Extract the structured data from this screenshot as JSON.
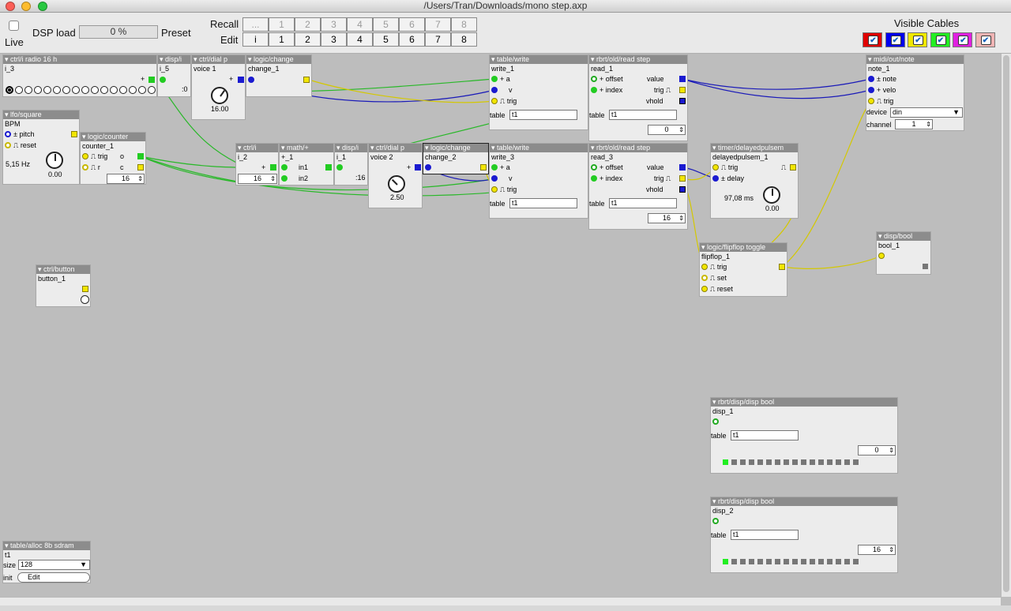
{
  "window": {
    "title": "/Users/Tran/Downloads/mono step.axp"
  },
  "toolbar": {
    "live_label": "Live",
    "dsp_label": "DSP load",
    "dsp_value": "0 %",
    "preset_label": "Preset",
    "recall_label": "Recall",
    "edit_label": "Edit",
    "recall_cells": [
      "...",
      "1",
      "2",
      "3",
      "4",
      "5",
      "6",
      "7",
      "8"
    ],
    "edit_cells": [
      "i",
      "1",
      "2",
      "3",
      "4",
      "5",
      "6",
      "7",
      "8"
    ],
    "visible_cables_label": "Visible Cables",
    "cable_colors": [
      "#e00000",
      "#0000ee",
      "#f0e800",
      "#22ee22",
      "#e020e0",
      "#f0b4b4"
    ],
    "check_mark": "✔"
  },
  "objects": {
    "radio": {
      "title": "ctrl/i radio 16 h",
      "name": "i_3",
      "plus": "+"
    },
    "disp_i5": {
      "title": "disp/i",
      "name": "i_5",
      "value": ":0"
    },
    "dial1": {
      "title": "ctrl/dial p",
      "name": "voice 1",
      "value": "16.00",
      "plus": "+"
    },
    "change1": {
      "title": "logic/change",
      "name": "change_1"
    },
    "lfo": {
      "title": "lfo/square",
      "name": "BPM",
      "pitch": "pitch",
      "reset": "reset",
      "freq": "5,15 Hz",
      "value": "0.00",
      "pm": "±"
    },
    "counter": {
      "title": "logic/counter",
      "name": "counter_1",
      "trig": "trig",
      "r": "r",
      "o": "o",
      "c": "c",
      "value": "16"
    },
    "ctrl_i2": {
      "title": "ctrl/i",
      "name": "i_2",
      "value": "16",
      "plus": "+"
    },
    "math": {
      "title": "math/+",
      "name": "+_1",
      "in1": "in1",
      "in2": "in2"
    },
    "disp_i1": {
      "title": "disp/i",
      "name": "i_1",
      "value": ":16"
    },
    "dial2": {
      "title": "ctrl/dial p",
      "name": "voice 2",
      "value": "2.50",
      "plus": "+"
    },
    "change2": {
      "title": "logic/change",
      "name": "change_2"
    },
    "write1": {
      "title": "table/write",
      "name": "write_1",
      "a": "a",
      "v": "v",
      "trig": "trig",
      "table_label": "table",
      "table": "t1"
    },
    "write3": {
      "title": "table/write",
      "name": "write_3",
      "a": "a",
      "v": "v",
      "trig": "trig",
      "table_label": "table",
      "table": "t1"
    },
    "read1": {
      "title": "rbrt/old/read step",
      "name": "read_1",
      "offset": "offset",
      "index": "index",
      "value": "value",
      "trig": "trig",
      "vhold": "vhold",
      "table_label": "table",
      "table": "t1",
      "spin": "0"
    },
    "read3": {
      "title": "rbrt/old/read step",
      "name": "read_3",
      "offset": "offset",
      "index": "index",
      "value": "value",
      "trig": "trig",
      "vhold": "vhold",
      "table_label": "table",
      "table": "t1",
      "spin": "16"
    },
    "midi": {
      "title": "midi/out/note",
      "name": "note_1",
      "note": "note",
      "velo": "velo",
      "trig": "trig",
      "device_label": "device",
      "device": "din",
      "channel_label": "channel",
      "channel": "1"
    },
    "timer": {
      "title": "timer/delayedpulsem",
      "name": "delayedpulsem_1",
      "trig": "trig",
      "delay": "delay",
      "ms": "97,08 ms",
      "value": "0.00"
    },
    "flipflop": {
      "title": "logic/flipflop toggle",
      "name": "flipflop_1",
      "trig": "trig",
      "set": "set",
      "reset": "reset"
    },
    "dispbool": {
      "title": "disp/bool",
      "name": "bool_1"
    },
    "button": {
      "title": "ctrl/button",
      "name": "button_1"
    },
    "disp1": {
      "title": "rbrt/disp/disp bool",
      "name": "disp_1",
      "table_label": "table",
      "table": "t1",
      "spin": "0"
    },
    "disp2": {
      "title": "rbrt/disp/disp bool",
      "name": "disp_2",
      "table_label": "table",
      "table": "t1",
      "spin": "16"
    },
    "alloc": {
      "title": "table/alloc 8b sdram",
      "name": "t1",
      "size_label": "size",
      "size": "128",
      "init_label": "init",
      "init": "Edit"
    }
  },
  "symbols": {
    "spin_arrows": "▲▼",
    "dropdown": "▼",
    "triangle": "▾",
    "pm": "±"
  }
}
